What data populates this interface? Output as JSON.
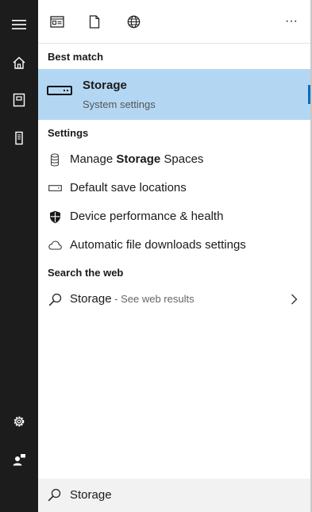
{
  "toolbar": {
    "more_label": "···"
  },
  "best_match": {
    "header": "Best match",
    "title": "Storage",
    "subtitle": "System settings"
  },
  "settings": {
    "header": "Settings",
    "items": [
      {
        "label_pre": "Manage ",
        "label_bold": "Storage",
        "label_post": " Spaces",
        "icon": "storage-spaces-icon"
      },
      {
        "label": "Default save locations",
        "icon": "drive-icon"
      },
      {
        "label": "Device performance & health",
        "icon": "shield-icon"
      },
      {
        "label": "Automatic file downloads settings",
        "icon": "cloud-icon"
      }
    ]
  },
  "web": {
    "header": "Search the web",
    "query": "Storage",
    "hint": " - See web results"
  },
  "search": {
    "value": "Storage"
  },
  "colors": {
    "rail": "#1c1c1c",
    "highlight": "#b3d7f3",
    "accent": "#0b6cbd"
  }
}
